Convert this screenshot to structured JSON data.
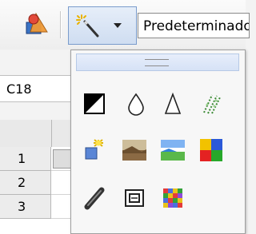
{
  "toolbar": {
    "shapes_icon": "shapes-icon",
    "filter_icon": "magic-wand-icon",
    "dropdown_icon": "chevron-down-icon",
    "style_value": "Predeterminado"
  },
  "namebox": {
    "value": "C18"
  },
  "rows": [
    "1",
    "2",
    "3"
  ],
  "popup": {
    "grip_icon": "drag-handle-icon",
    "filters": [
      "invert-filter-icon",
      "smooth-filter-icon",
      "sharpen-filter-icon",
      "remove-noise-filter-icon",
      "solarization-filter-icon",
      "aging-filter-icon",
      "posterize-filter-icon",
      "pop-art-filter-icon",
      "charcoal-sketch-filter-icon",
      "relief-filter-icon",
      "mosaic-filter-icon"
    ]
  },
  "colors": {
    "toolbar_bg": "#eeeeee",
    "highlight_border": "#7a9ccc",
    "highlight_bg": "#d6e2f6"
  }
}
